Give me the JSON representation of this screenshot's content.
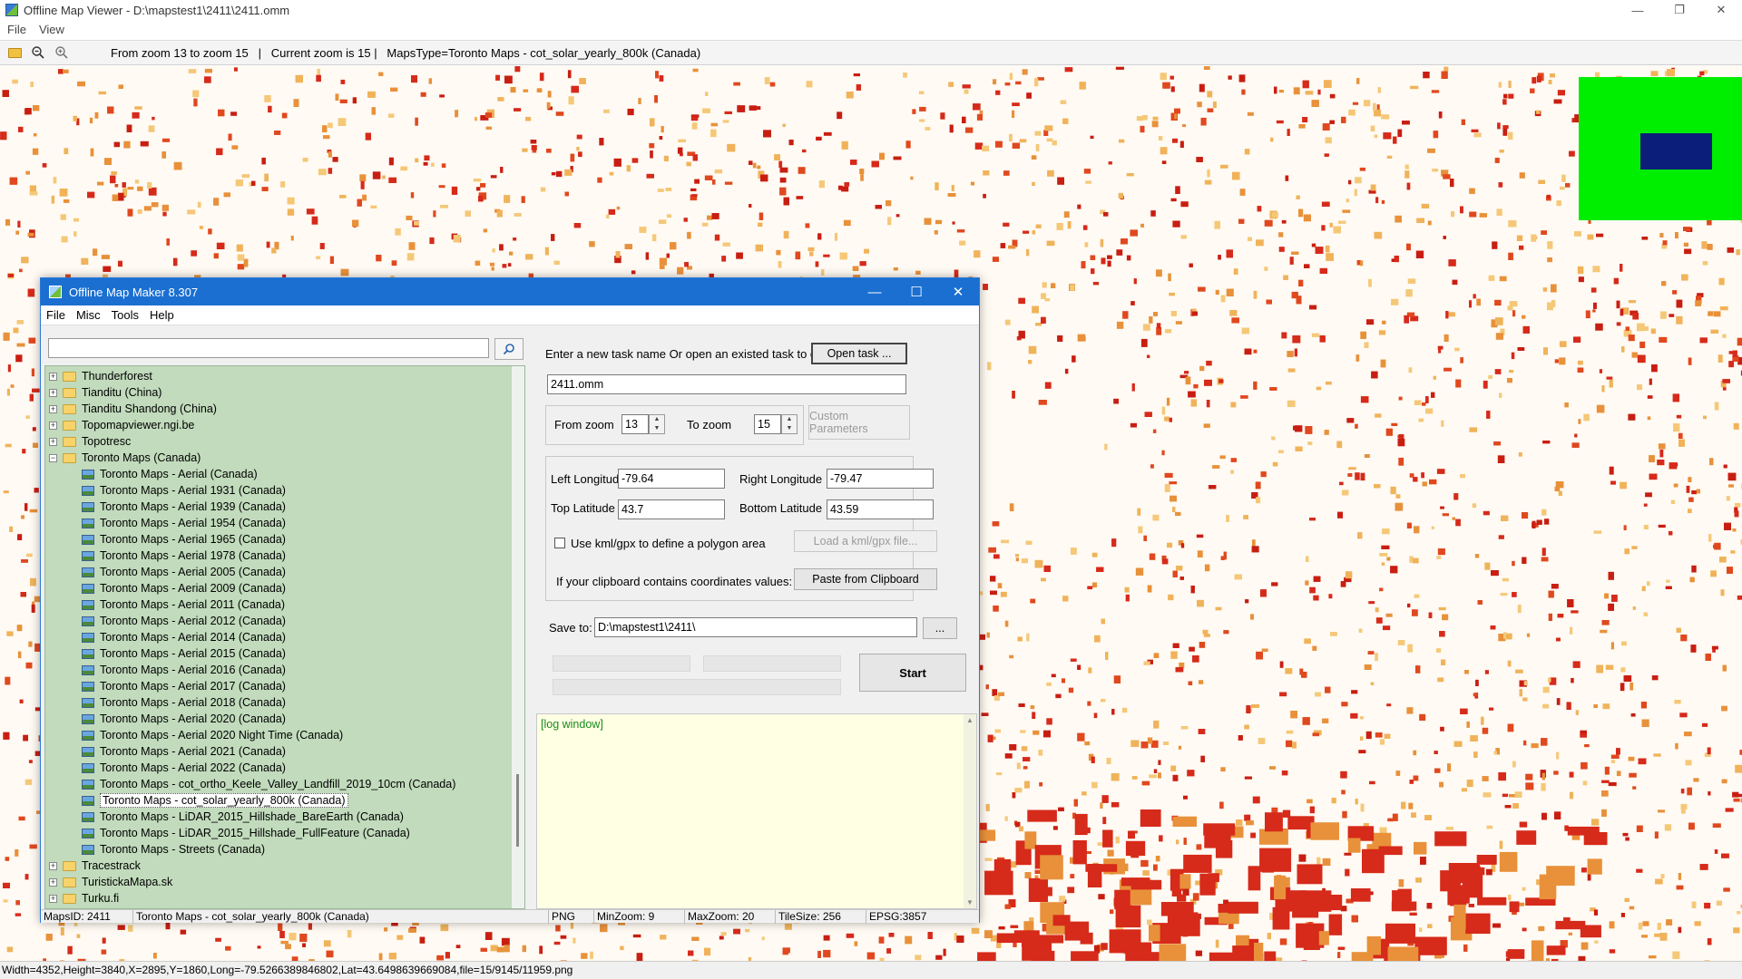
{
  "viewer": {
    "title": "Offline Map Viewer - D:\\mapstest1\\2411\\2411.omm",
    "menu": [
      "File",
      "View"
    ],
    "toolbar_info": "From zoom 13 to zoom 15   |   Current zoom is 15 |   MapsType=Toronto Maps - cot_solar_yearly_800k (Canada)",
    "status": "Width=4352,Height=3840,X=2895,Y=1860,Long=-79.5266389846802,Lat=43.6498639669084,file=15/9145/11959.png",
    "icons": [
      "open-folder-icon",
      "zoom-out-icon",
      "zoom-in-icon"
    ]
  },
  "dialog": {
    "title": "Offline Map Maker 8.307",
    "menu": [
      "File",
      "Misc",
      "Tools",
      "Help"
    ],
    "tree": {
      "items": [
        {
          "label": "Thunderforest",
          "type": "folder",
          "expanded": false,
          "level": 0
        },
        {
          "label": "Tianditu (China)",
          "type": "folder",
          "expanded": false,
          "level": 0
        },
        {
          "label": "Tianditu Shandong (China)",
          "type": "folder",
          "expanded": false,
          "level": 0
        },
        {
          "label": "Topomapviewer.ngi.be",
          "type": "folder",
          "expanded": false,
          "level": 0
        },
        {
          "label": "Topotresc",
          "type": "folder",
          "expanded": false,
          "level": 0
        },
        {
          "label": "Toronto Maps (Canada)",
          "type": "folder",
          "expanded": true,
          "level": 0
        },
        {
          "label": "Toronto Maps - Aerial (Canada)",
          "type": "map",
          "level": 1
        },
        {
          "label": "Toronto Maps - Aerial 1931 (Canada)",
          "type": "map",
          "level": 1
        },
        {
          "label": "Toronto Maps - Aerial 1939 (Canada)",
          "type": "map",
          "level": 1
        },
        {
          "label": "Toronto Maps - Aerial 1954 (Canada)",
          "type": "map",
          "level": 1
        },
        {
          "label": "Toronto Maps - Aerial 1965 (Canada)",
          "type": "map",
          "level": 1
        },
        {
          "label": "Toronto Maps - Aerial 1978 (Canada)",
          "type": "map",
          "level": 1
        },
        {
          "label": "Toronto Maps - Aerial 2005 (Canada)",
          "type": "map",
          "level": 1
        },
        {
          "label": "Toronto Maps - Aerial 2009 (Canada)",
          "type": "map",
          "level": 1
        },
        {
          "label": "Toronto Maps - Aerial 2011 (Canada)",
          "type": "map",
          "level": 1
        },
        {
          "label": "Toronto Maps - Aerial 2012 (Canada)",
          "type": "map",
          "level": 1
        },
        {
          "label": "Toronto Maps - Aerial 2014 (Canada)",
          "type": "map",
          "level": 1
        },
        {
          "label": "Toronto Maps - Aerial 2015 (Canada)",
          "type": "map",
          "level": 1
        },
        {
          "label": "Toronto Maps - Aerial 2016 (Canada)",
          "type": "map",
          "level": 1
        },
        {
          "label": "Toronto Maps - Aerial 2017 (Canada)",
          "type": "map",
          "level": 1
        },
        {
          "label": "Toronto Maps - Aerial 2018 (Canada)",
          "type": "map",
          "level": 1
        },
        {
          "label": "Toronto Maps - Aerial 2020 (Canada)",
          "type": "map",
          "level": 1
        },
        {
          "label": "Toronto Maps - Aerial 2020 Night Time (Canada)",
          "type": "map",
          "level": 1
        },
        {
          "label": "Toronto Maps - Aerial 2021 (Canada)",
          "type": "map",
          "level": 1
        },
        {
          "label": "Toronto Maps - Aerial 2022 (Canada)",
          "type": "map",
          "level": 1
        },
        {
          "label": "Toronto Maps - cot_ortho_Keele_Valley_Landfill_2019_10cm (Canada)",
          "type": "map",
          "level": 1
        },
        {
          "label": "Toronto Maps - cot_solar_yearly_800k (Canada)",
          "type": "map",
          "level": 1,
          "selected": true
        },
        {
          "label": "Toronto Maps - LiDAR_2015_Hillshade_BareEarth (Canada)",
          "type": "map",
          "level": 1
        },
        {
          "label": "Toronto Maps - LiDAR_2015_Hillshade_FullFeature (Canada)",
          "type": "map",
          "level": 1
        },
        {
          "label": "Toronto Maps - Streets (Canada)",
          "type": "map",
          "level": 1
        },
        {
          "label": "Tracestrack",
          "type": "folder",
          "expanded": false,
          "level": 0
        },
        {
          "label": "TuristickaMapa.sk",
          "type": "folder",
          "expanded": false,
          "level": 0
        },
        {
          "label": "Turku.fi",
          "type": "folder",
          "expanded": false,
          "level": 0
        }
      ]
    },
    "task": {
      "prompt": "Enter a new task name Or open an existed task to continue:",
      "open_button": "Open task ...",
      "name_value": "2411.omm"
    },
    "zoom": {
      "from_label": "From zoom",
      "from_value": "13",
      "to_label": "To zoom",
      "to_value": "15",
      "custom_button": "Custom Parameters"
    },
    "bounds": {
      "left_lon_label": "Left Longitude",
      "left_lon_value": "-79.64",
      "right_lon_label": "Right Longitude",
      "right_lon_value": "-79.47",
      "top_lat_label": "Top Latitude",
      "top_lat_value": "43.7",
      "bottom_lat_label": "Bottom Latitude",
      "bottom_lat_value": "43.59",
      "kml_label": "Use kml/gpx to define a polygon area",
      "kml_button": "Load a kml/gpx file...",
      "clipboard_label": "If your clipboard contains coordinates values:",
      "clipboard_button": "Paste from Clipboard"
    },
    "save": {
      "label": "Save to:",
      "value": "D:\\mapstest1\\2411\\",
      "browse_button": "..."
    },
    "start_button": "Start",
    "log_text": "[log window]",
    "status": {
      "maps_id": "MapsID: 2411",
      "maps_name": "Toronto Maps - cot_solar_yearly_800k (Canada)",
      "format": "PNG",
      "min_zoom": "MinZoom: 9",
      "max_zoom": "MaxZoom: 20",
      "tile_size": "TileSize: 256",
      "epsg": "EPSG:3857"
    }
  },
  "colors": {
    "dialog_title": "#1a6fd1",
    "tree_bg": "#c1dbbc",
    "log_bg": "#ffffe4",
    "log_text": "#1a8a1a",
    "minimap_bg": "#00ee00",
    "minimap_viewport": "#0b1f7a",
    "map_red": "#d62a1a",
    "map_orange": "#e8913a"
  }
}
